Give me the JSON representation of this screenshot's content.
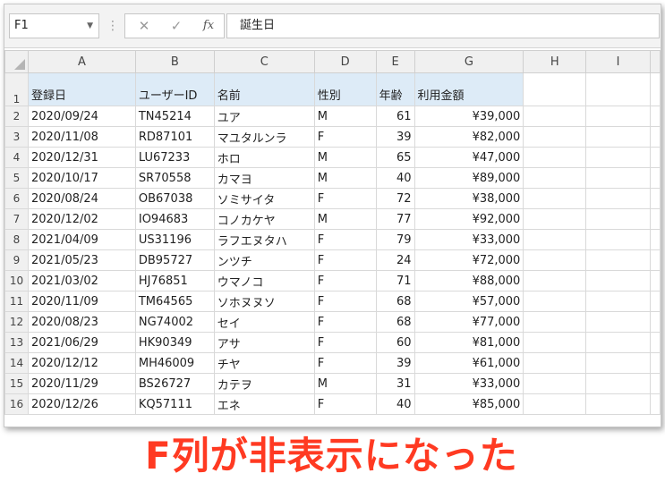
{
  "namebox": {
    "value": "F1"
  },
  "formula_bar": {
    "cancel_glyph": "✕",
    "enter_glyph": "✓",
    "fx_label": "fx",
    "content": "誕生日"
  },
  "columns": [
    "A",
    "B",
    "C",
    "D",
    "E",
    "G",
    "H",
    "I"
  ],
  "hidden_column": "F",
  "headers": [
    "登録日",
    "ユーザーID",
    "名前",
    "性別",
    "年齢",
    "利用金額"
  ],
  "rows": [
    {
      "n": "2",
      "cells": [
        "2020/09/24",
        "TN45214",
        "ユア",
        "M",
        "61",
        "¥39,000"
      ]
    },
    {
      "n": "3",
      "cells": [
        "2020/11/08",
        "RD87101",
        "マユタルンラ",
        "F",
        "39",
        "¥82,000"
      ]
    },
    {
      "n": "4",
      "cells": [
        "2020/12/31",
        "LU67233",
        "ホロ",
        "M",
        "65",
        "¥47,000"
      ]
    },
    {
      "n": "5",
      "cells": [
        "2020/10/17",
        "SR70558",
        "カマヨ",
        "M",
        "40",
        "¥89,000"
      ]
    },
    {
      "n": "6",
      "cells": [
        "2020/08/24",
        "OB67038",
        "ソミサイタ",
        "F",
        "72",
        "¥38,000"
      ]
    },
    {
      "n": "7",
      "cells": [
        "2020/12/02",
        "IO94683",
        "コノカケヤ",
        "M",
        "77",
        "¥92,000"
      ]
    },
    {
      "n": "8",
      "cells": [
        "2021/04/09",
        "US31196",
        "ラフエヌタハ",
        "F",
        "79",
        "¥33,000"
      ]
    },
    {
      "n": "9",
      "cells": [
        "2021/05/23",
        "DB95727",
        "ンツチ",
        "F",
        "24",
        "¥72,000"
      ]
    },
    {
      "n": "10",
      "cells": [
        "2021/03/02",
        "HJ76851",
        "ウマノコ",
        "F",
        "71",
        "¥88,000"
      ]
    },
    {
      "n": "11",
      "cells": [
        "2020/11/09",
        "TM64565",
        "ソホヌヌソ",
        "F",
        "68",
        "¥57,000"
      ]
    },
    {
      "n": "12",
      "cells": [
        "2020/08/23",
        "NG74002",
        "セイ",
        "F",
        "68",
        "¥77,000"
      ]
    },
    {
      "n": "13",
      "cells": [
        "2021/06/29",
        "HK90349",
        "アサ",
        "F",
        "60",
        "¥81,000"
      ]
    },
    {
      "n": "14",
      "cells": [
        "2020/12/12",
        "MH46009",
        "チヤ",
        "F",
        "39",
        "¥61,000"
      ]
    },
    {
      "n": "15",
      "cells": [
        "2020/11/29",
        "BS26727",
        "カテヲ",
        "M",
        "31",
        "¥33,000"
      ]
    },
    {
      "n": "16",
      "cells": [
        "2020/12/26",
        "KQ57111",
        "エネ",
        "F",
        "40",
        "¥85,000"
      ]
    }
  ],
  "annotation": "F列が非表示になった",
  "colors": {
    "header_fill": "#ddebf7",
    "annotation": "#ff3a22",
    "gridline": "#d9d9d9"
  }
}
